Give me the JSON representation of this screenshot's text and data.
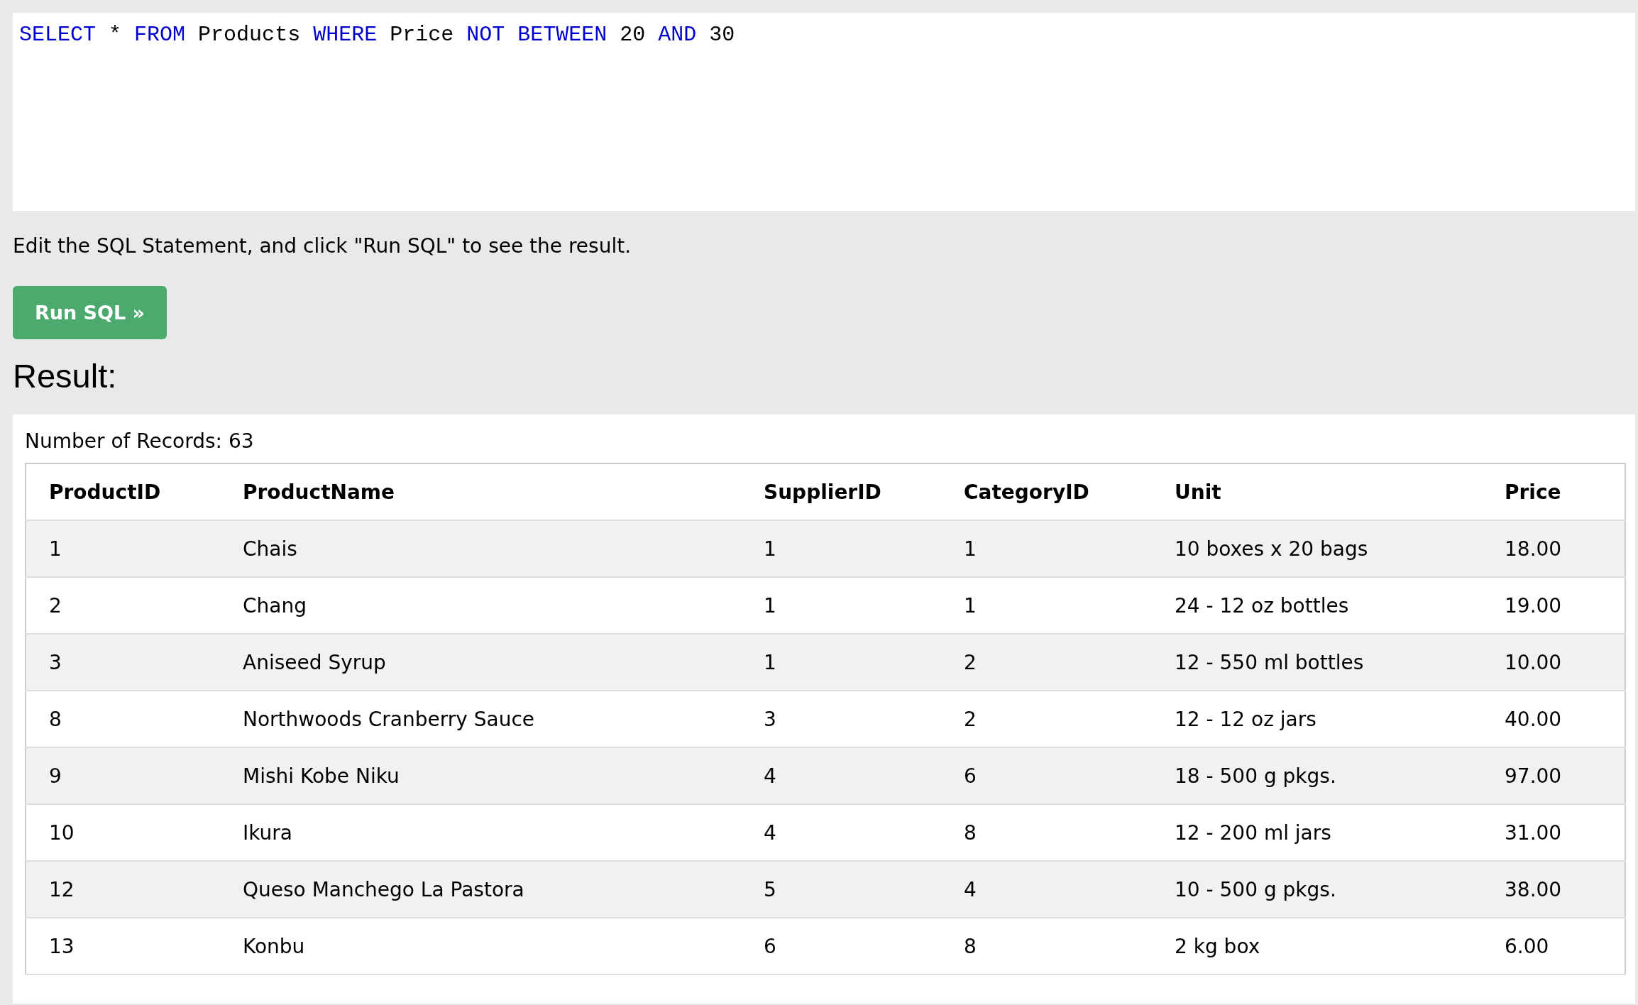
{
  "editor": {
    "tokens": [
      {
        "kind": "keyword",
        "text": "SELECT"
      },
      {
        "kind": "plain",
        "text": "*"
      },
      {
        "kind": "keyword",
        "text": "FROM"
      },
      {
        "kind": "plain",
        "text": "Products"
      },
      {
        "kind": "keyword",
        "text": "WHERE"
      },
      {
        "kind": "plain",
        "text": "Price"
      },
      {
        "kind": "keyword",
        "text": "NOT"
      },
      {
        "kind": "keyword",
        "text": "BETWEEN"
      },
      {
        "kind": "plain",
        "text": "20"
      },
      {
        "kind": "keyword",
        "text": "AND"
      },
      {
        "kind": "plain",
        "text": "30"
      }
    ]
  },
  "instructions": "Edit the SQL Statement, and click \"Run SQL\" to see the result.",
  "run_button": "Run SQL »",
  "result_heading": "Result:",
  "record_count": "Number of Records: 63",
  "table": {
    "columns": [
      "ProductID",
      "ProductName",
      "SupplierID",
      "CategoryID",
      "Unit",
      "Price"
    ],
    "rows": [
      [
        "1",
        "Chais",
        "1",
        "1",
        "10 boxes x 20 bags",
        "18.00"
      ],
      [
        "2",
        "Chang",
        "1",
        "1",
        "24 - 12 oz bottles",
        "19.00"
      ],
      [
        "3",
        "Aniseed Syrup",
        "1",
        "2",
        "12 - 550 ml bottles",
        "10.00"
      ],
      [
        "8",
        "Northwoods Cranberry Sauce",
        "3",
        "2",
        "12 - 12 oz jars",
        "40.00"
      ],
      [
        "9",
        "Mishi Kobe Niku",
        "4",
        "6",
        "18 - 500 g pkgs.",
        "97.00"
      ],
      [
        "10",
        "Ikura",
        "4",
        "8",
        "12 - 200 ml jars",
        "31.00"
      ],
      [
        "12",
        "Queso Manchego La Pastora",
        "5",
        "4",
        "10 - 500 g pkgs.",
        "38.00"
      ],
      [
        "13",
        "Konbu",
        "6",
        "8",
        "2 kg box",
        "6.00"
      ]
    ]
  }
}
